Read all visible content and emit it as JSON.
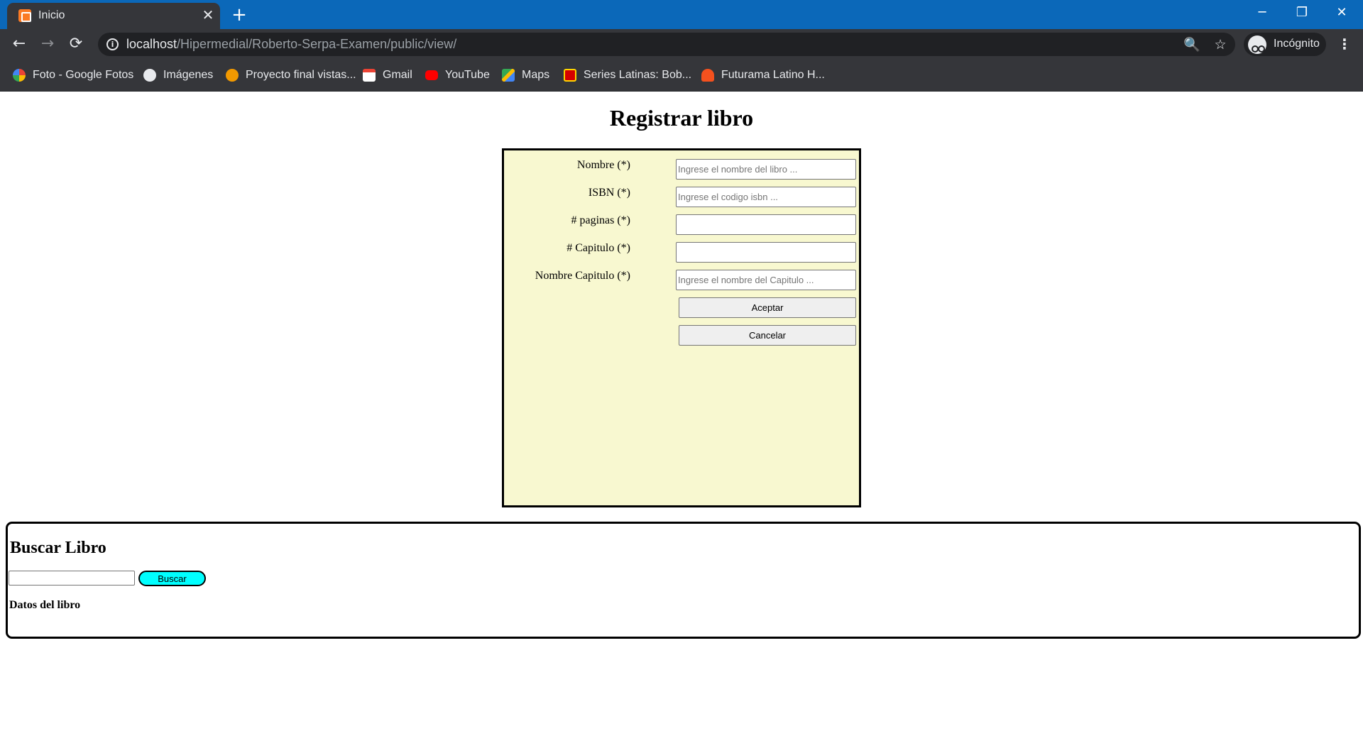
{
  "browser": {
    "tab_title": "Inicio",
    "tab_close": "✕",
    "new_tab": "+",
    "window_controls": {
      "minimize": "─",
      "restore": "❐",
      "close": "✕"
    },
    "nav": {
      "back": "←",
      "forward": "→",
      "reload": "⟳"
    },
    "url_host": "localhost",
    "url_path": "/Hipermedial/Roberto-Serpa-Examen/public/view/",
    "info_icon": "i",
    "zoom_icon": "🔍",
    "bookmark_star": "☆",
    "incognito_label": "Incógnito",
    "menu_icon": "⋮"
  },
  "bookmarks": [
    {
      "label": "Foto - Google Fotos",
      "icon": "google-photos-icon",
      "color": "#fbbc04"
    },
    {
      "label": "Imágenes",
      "icon": "globe-icon",
      "color": "#e8eaed"
    },
    {
      "label": "Proyecto final vistas...",
      "icon": "project-icon",
      "color": "#f29900"
    },
    {
      "label": "Gmail",
      "icon": "gmail-icon",
      "color": "#ea4335"
    },
    {
      "label": "YouTube",
      "icon": "youtube-icon",
      "color": "#ff0000"
    },
    {
      "label": "Maps",
      "icon": "maps-icon",
      "color": "#34a853"
    },
    {
      "label": "Series Latinas: Bob...",
      "icon": "series-latinas-icon",
      "color": "#d50000"
    },
    {
      "label": "Futurama Latino H...",
      "icon": "futurama-icon",
      "color": "#f4511e"
    }
  ],
  "page": {
    "title": "Registrar libro"
  },
  "form": {
    "fields": [
      {
        "label": "Nombre (*)",
        "placeholder": "Ingrese el nombre del libro ...",
        "value": ""
      },
      {
        "label": "ISBN (*)",
        "placeholder": "Ingrese el codigo isbn ...",
        "value": ""
      },
      {
        "label": "# paginas (*)",
        "placeholder": "",
        "value": ""
      },
      {
        "label": "# Capitulo (*)",
        "placeholder": "",
        "value": ""
      },
      {
        "label": "Nombre Capitulo (*)",
        "placeholder": "Ingrese el nombre del Capitulo ...",
        "value": ""
      }
    ],
    "accept_label": "Aceptar",
    "cancel_label": "Cancelar",
    "panel_color": "#f8f8d0"
  },
  "search": {
    "title": "Buscar Libro",
    "input_value": "",
    "button_label": "Buscar",
    "button_color": "#00ffff",
    "results_label": "Datos del libro"
  },
  "colors": {
    "tabstrip": "#0b68b9",
    "toolbar": "#35363a"
  }
}
